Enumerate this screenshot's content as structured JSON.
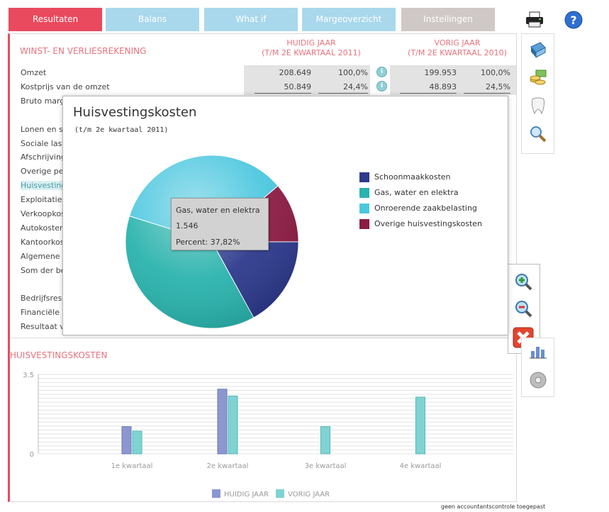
{
  "tabs": [
    {
      "label": "Resultaten"
    },
    {
      "label": "Balans"
    },
    {
      "label": "What if"
    },
    {
      "label": "Margeoverzicht"
    },
    {
      "label": "Instellingen"
    }
  ],
  "report": {
    "title": "WINST- EN VERLIESREKENING",
    "col_current_1": "HUIDIG JAAR",
    "col_current_2": "(T/M 2E KWARTAAL 2011)",
    "col_prev_1": "VORIG JAAR",
    "col_prev_2": "(T/M 2E KWARTAAL 2010)",
    "rows": [
      {
        "label": "Omzet",
        "cur": "208.649",
        "cur_pct": "100,0%",
        "prev": "199.953",
        "prev_pct": "100,0%"
      },
      {
        "label": "Kostprijs van de omzet",
        "cur": "50.849",
        "cur_pct": "24,4%",
        "prev": "48.893",
        "prev_pct": "24,5%"
      },
      {
        "label": "Bruto marg"
      },
      {
        "label": "Lonen en s"
      },
      {
        "label": "Sociale last"
      },
      {
        "label": "Afschrijving"
      },
      {
        "label": "Overige pe"
      },
      {
        "label": "Huisvesting"
      },
      {
        "label": "Exploitatiek"
      },
      {
        "label": "Verkoopkos"
      },
      {
        "label": "Autokoster"
      },
      {
        "label": "Kantoorkos"
      },
      {
        "label": "Algemene k"
      },
      {
        "label": "Som der be"
      },
      {
        "label": "Bedrijfsresu"
      },
      {
        "label": "Financiële"
      },
      {
        "label": "Resultaat v"
      }
    ]
  },
  "popup": {
    "title": "Huisvestingskosten",
    "subtitle": "(t/m 2e kwartaal 2011)",
    "tooltip": {
      "name": "Gas, water en elektra",
      "value": "1.546",
      "percent": "Percent: 37,82%"
    }
  },
  "chart_data": [
    {
      "type": "pie",
      "title": "Huisvestingskosten",
      "subtitle": "(t/m 2e kwartaal 2011)",
      "labels": [
        "Schoonmaakkosten",
        "Gas, water en elektra",
        "Onroerende zaakbelasting",
        "Overige huisvestingskosten"
      ],
      "values": [
        17.0,
        37.82,
        34.0,
        11.18
      ],
      "colors": [
        "#2e3a8c",
        "#2bb3ad",
        "#4cc7df",
        "#8c1c44"
      ],
      "legend": "right"
    },
    {
      "type": "bar",
      "title": "HUISVESTINGSKOSTEN",
      "categories": [
        "1e kwartaal",
        "2e kwartaal",
        "3e kwartaal",
        "4e kwartaal"
      ],
      "series": [
        {
          "name": "HUIDIG JAAR",
          "values": [
            1.2,
            2.85,
            null,
            null
          ]
        },
        {
          "name": "VORIG JAAR",
          "values": [
            1.0,
            2.55,
            1.2,
            2.5
          ]
        }
      ],
      "ylim": [
        0,
        3.5
      ],
      "yticks": [
        "3.5",
        "0"
      ],
      "colors": {
        "huidig": "#8c97d0",
        "vorig": "#7fd3d3"
      },
      "legend": "bottom",
      "grid": true
    }
  ],
  "bottom": {
    "title": "HUISVESTINGSKOSTEN"
  },
  "footnote": "geen accountantscontrole toegepast",
  "icons": [
    "printer-icon",
    "help-icon",
    "book-icon",
    "coins-icon",
    "tooth-icon",
    "magnifier-icon",
    "zoom-in-icon",
    "zoom-out-icon",
    "close-icon",
    "chart-icon",
    "disc-icon",
    "info-icon"
  ]
}
